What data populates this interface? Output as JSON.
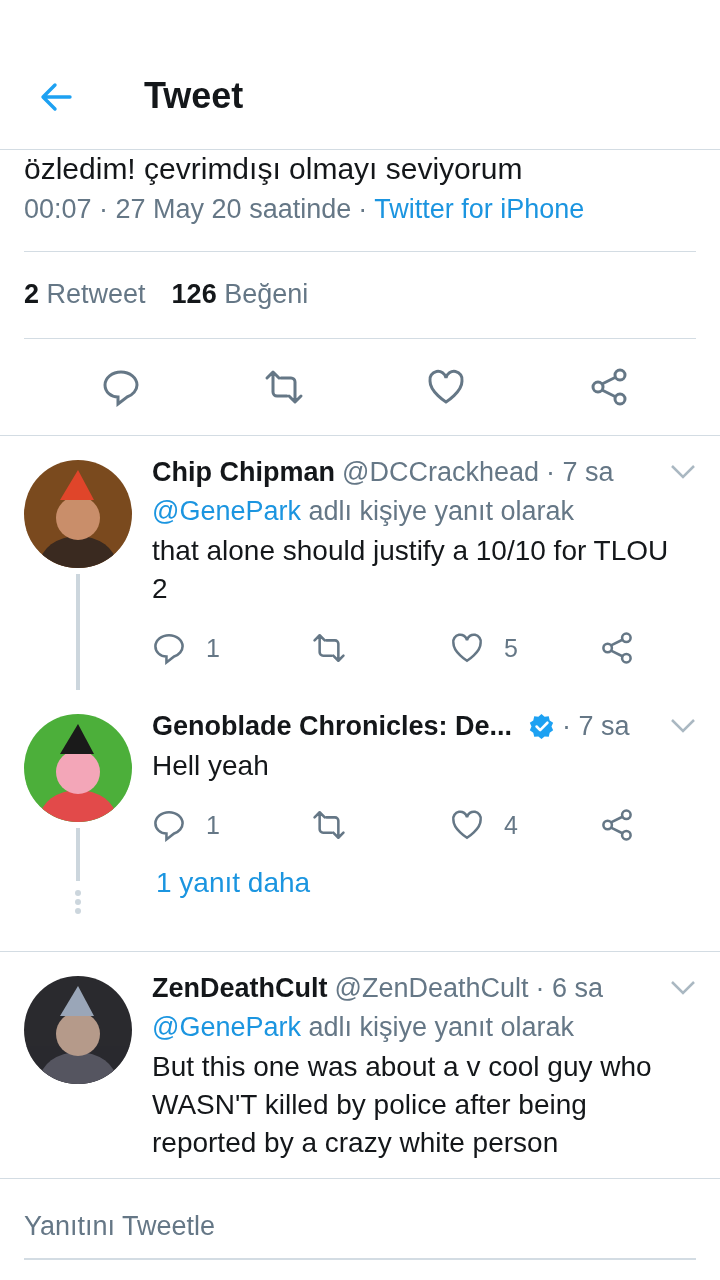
{
  "header": {
    "title": "Tweet"
  },
  "tweet": {
    "text_tail": "özledim! çevrimdışı olmayı seviyorum",
    "timestamp": "00:07 · 27 May 20 saatinde",
    "separator": "·",
    "source": "Twitter for iPhone",
    "retweet_count": "2",
    "retweet_label": "Retweet",
    "like_count": "126",
    "like_label": "Beğeni"
  },
  "replies": [
    {
      "name": "Chip Chipman",
      "handle": "@DCCrackhead",
      "time": "· 7 sa",
      "reply_to": "@GenePark",
      "reply_to_suffix": "adlı kişiye yanıt olarak",
      "text": "that alone should justify a 10/10 for TLOU 2",
      "reply_count": "1",
      "like_count": "5",
      "thread_below": true
    },
    {
      "name": "Genoblade Chronicles: De...",
      "verified": true,
      "time": "· 7 sa",
      "text": "Hell yeah",
      "reply_count": "1",
      "like_count": "4",
      "thread_below": true,
      "more_replies": "1 yanıt daha"
    },
    {
      "name": "ZenDeathCult",
      "handle": "@ZenDeathCult",
      "time": "· 6 sa",
      "reply_to": "@GenePark",
      "reply_to_suffix": "adlı kişiye yanıt olarak",
      "text": "But this one was about a v cool guy who WASN'T killed by police after being reported by a crazy white person",
      "thread_below": false
    }
  ],
  "composer": {
    "placeholder": "Yanıtını Tweetle"
  }
}
